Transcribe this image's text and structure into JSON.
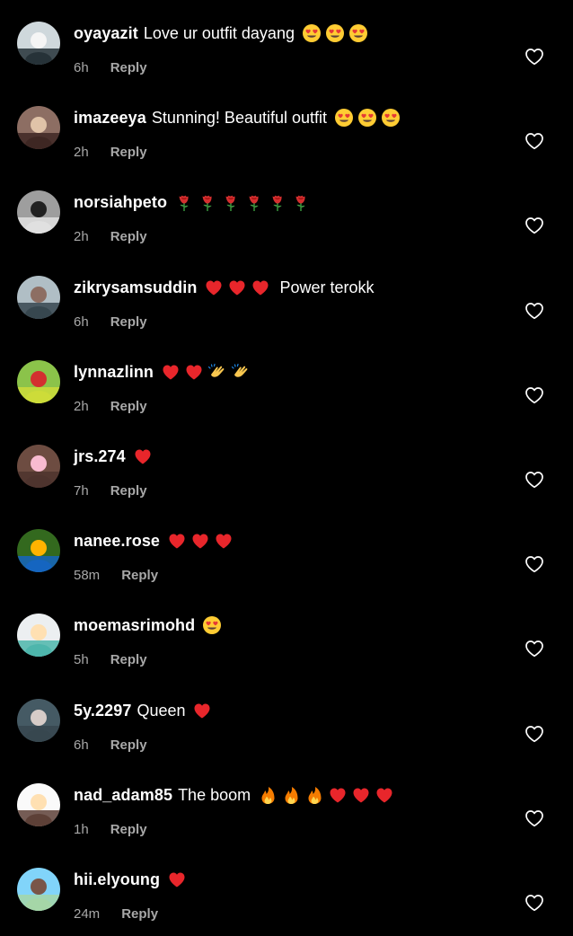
{
  "colors": {
    "background": "#000000",
    "text": "#ffffff",
    "meta": "#a8a8a8"
  },
  "reply_label": "Reply",
  "comments": [
    {
      "username": "oyayazit",
      "text": "Love ur outfit dayang",
      "emojis": [
        "heart-eyes",
        "heart-eyes",
        "heart-eyes"
      ],
      "emojis_first": false,
      "time": "6h",
      "avatar": "avatar-1"
    },
    {
      "username": "imazeeya",
      "text": "Stunning! Beautiful outfit",
      "emojis": [
        "heart-eyes",
        "heart-eyes",
        "heart-eyes"
      ],
      "emojis_first": false,
      "time": "2h",
      "avatar": "avatar-2"
    },
    {
      "username": "norsiahpeto",
      "text": "",
      "emojis": [
        "rose",
        "rose",
        "rose",
        "rose",
        "rose",
        "rose"
      ],
      "emojis_first": false,
      "time": "2h",
      "avatar": "avatar-3"
    },
    {
      "username": "zikrysamsuddin",
      "text": "Power terokk",
      "emojis": [
        "red-heart",
        "red-heart",
        "red-heart"
      ],
      "emojis_first": true,
      "time": "6h",
      "avatar": "avatar-4"
    },
    {
      "username": "lynnazlinn",
      "text": "",
      "emojis": [
        "red-heart",
        "red-heart",
        "clap",
        "clap"
      ],
      "emojis_first": false,
      "time": "2h",
      "avatar": "avatar-5"
    },
    {
      "username": "jrs.274",
      "text": "",
      "emojis": [
        "red-heart"
      ],
      "emojis_first": false,
      "time": "7h",
      "avatar": "avatar-6"
    },
    {
      "username": "nanee.rose",
      "text": "",
      "emojis": [
        "red-heart",
        "red-heart",
        "red-heart"
      ],
      "emojis_first": false,
      "time": "58m",
      "avatar": "avatar-7"
    },
    {
      "username": "moemasrimohd",
      "text": "",
      "emojis": [
        "heart-eyes"
      ],
      "emojis_first": false,
      "time": "5h",
      "avatar": "avatar-8"
    },
    {
      "username": "5y.2297",
      "text": "Queen",
      "emojis": [
        "red-heart"
      ],
      "emojis_first": false,
      "time": "6h",
      "avatar": "avatar-9"
    },
    {
      "username": "nad_adam85",
      "text": "The boom",
      "emojis": [
        "fire",
        "fire",
        "fire",
        "red-heart",
        "red-heart",
        "red-heart"
      ],
      "emojis_first": false,
      "time": "1h",
      "avatar": "avatar-10"
    },
    {
      "username": "hii.elyoung",
      "text": "",
      "emojis": [
        "red-heart"
      ],
      "emojis_first": false,
      "time": "24m",
      "avatar": "avatar-11"
    }
  ]
}
